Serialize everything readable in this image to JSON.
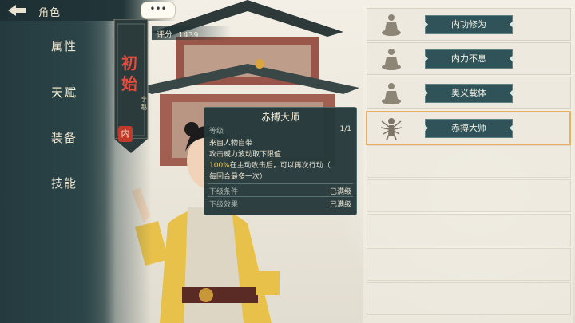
{
  "header": {
    "title": "角色"
  },
  "menu": {
    "items": [
      {
        "label": "属性"
      },
      {
        "label": "天赋"
      },
      {
        "label": "装备"
      },
      {
        "label": "技能"
      }
    ]
  },
  "character": {
    "banner_title": "初始",
    "banner_name": "李魁",
    "seal": "内",
    "score_label": "评分",
    "score_value": "1439",
    "chat_dots": "•••"
  },
  "tooltip": {
    "title": "赤搏大师",
    "level_label": "等级",
    "level_value": "1/1",
    "source": "来自人物自带",
    "desc1": "攻击威力波动取下限值",
    "desc2_highlight": "100%",
    "desc2_rest": "在主动攻击后，可以再次行动（",
    "desc3": "每回合最多一次）",
    "next_condition_label": "下级条件",
    "next_condition_value": "已满级",
    "next_effect_label": "下级效果",
    "next_effect_value": "已满级"
  },
  "talents": [
    {
      "label": "内功修为",
      "icon": "meditating-figure-icon"
    },
    {
      "label": "内力不息",
      "icon": "meditating-figure-icon"
    },
    {
      "label": "奥义载体",
      "icon": "meditating-figure-icon"
    },
    {
      "label": "赤搏大师",
      "icon": "multi-armed-figure-icon",
      "selected": true
    }
  ],
  "colors": {
    "accent_gold": "#e9b061",
    "panel_teal": "#2f5358",
    "seal_red": "#c0392b"
  }
}
